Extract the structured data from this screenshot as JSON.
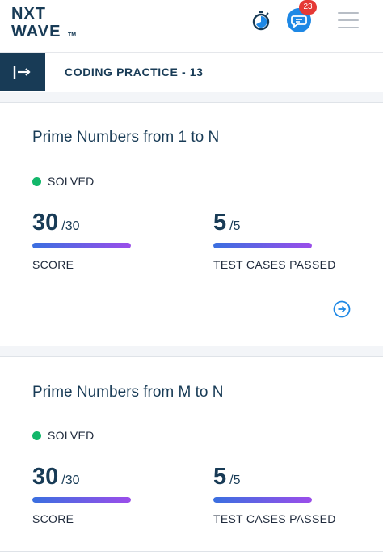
{
  "header": {
    "logo_line1": "NXT",
    "logo_line2": "WAVE",
    "logo_tm": "TM",
    "notification_count": "23",
    "icons": [
      "stopwatch-icon",
      "chat-icon",
      "hamburger-menu-icon"
    ]
  },
  "subheader": {
    "title": "CODING PRACTICE - 13",
    "collapse_icon": "sidebar-expand-icon"
  },
  "questions": [
    {
      "title": "Prime Numbers from 1 to N",
      "status": "SOLVED",
      "score": "30",
      "score_total": "/30",
      "score_label": "SCORE",
      "score_progress": 1.0,
      "tests": "5",
      "tests_total": "/5",
      "tests_label": "TEST CASES PASSED",
      "tests_progress": 1.0
    },
    {
      "title": "Prime Numbers from M to N",
      "status": "SOLVED",
      "score": "30",
      "score_total": "/30",
      "score_label": "SCORE",
      "score_progress": 1.0,
      "tests": "5",
      "tests_total": "/5",
      "tests_label": "TEST CASES PASSED",
      "tests_progress": 1.0
    }
  ],
  "colors": {
    "brand_navy": "#183b56",
    "solved_green": "#12b76a",
    "chat_blue": "#1e88e5",
    "badge_red": "#e53935",
    "progress_start": "#3a6fe0",
    "progress_end": "#9b4dea"
  }
}
